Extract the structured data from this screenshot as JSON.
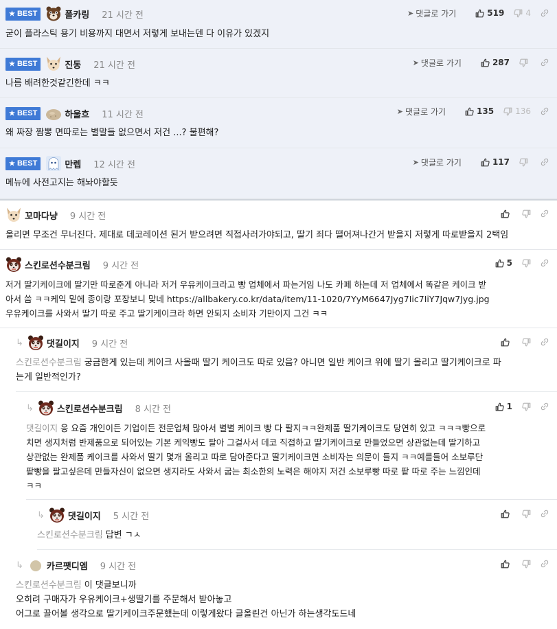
{
  "labels": {
    "best": "BEST",
    "goto_reply": "댓글로 가기"
  },
  "colors": {
    "best_bg": "#eef1f8",
    "badge": "#3f7ad6"
  },
  "best_comments": [
    {
      "nick": "폴카링",
      "time": "21 시간 전",
      "likes": "519",
      "dislikes": "4",
      "text": "굳이 플라스틱 용기 비용까지 대면서 저렇게 보내는덴 다 이유가 있겠지",
      "avatar": "bear-avatar-icon"
    },
    {
      "nick": "진동",
      "time": "21 시간 전",
      "likes": "287",
      "dislikes": "",
      "text": "나름 배려한것같긴한데 ㅋㅋ",
      "avatar": "fox-avatar-icon"
    },
    {
      "nick": "하울흐",
      "time": "11 시간 전",
      "likes": "135",
      "dislikes": "136",
      "text": "왜 짜장 짬뽕 면따로는 별말들 없으면서 저건 ...? 불편해?",
      "avatar": "potato-avatar-icon"
    },
    {
      "nick": "만렙",
      "time": "12 시간 전",
      "likes": "117",
      "dislikes": "",
      "text": "메뉴에 사전고지는 해놔야할듯",
      "avatar": "ghost-avatar-icon"
    }
  ],
  "comments": [
    {
      "nick": "꼬마다냥",
      "time": "9 시간 전",
      "likes": "",
      "lines": [
        "올리면 무조건 무너진다. 제대로 데코레이션 된거 받으려면 직접사러가야되고, 딸기 죄다 떨어져나간거 받을지 저렇게 따로받을지 2택임"
      ],
      "avatar": "fox-avatar-icon"
    },
    {
      "nick": "스킨로션수분크림",
      "time": "9 시간 전",
      "likes": "5",
      "lines": [
        "저거 딸기케이크에 딸기만 따로준게 아니라 저거 우유케이크라고 빵 업체에서 파는거임 나도 카페 하는데 저 업체에서 똑같은 케이크 받",
        "아서 씀 ㅋㅋ케익 밑에 종이랑 포장보니 맞네 https://allbakery.co.kr/data/item/11-1020/7YyM6647Jyg7Iic7IiY7Jqw7Jyg.jpg",
        "우유케이크를 사와서 딸기 따로 주고 딸기케이크라 하면 안되지 소비자 기만이지 그건 ㅋㅋ"
      ],
      "avatar": "panda-avatar-icon"
    }
  ],
  "replies": [
    {
      "nick": "댓길이지",
      "time": "9 시간 전",
      "likes": "",
      "mention": "스킨로션수분크림",
      "lines": [
        "궁금한게 있는데 케이크 사올때 딸기 케이크도 따로 있음? 아니면 일반 케이크 위에 딸기 올리고 딸기케이크로 파",
        "는게 일반적인가?"
      ],
      "avatar": "panda-avatar-icon"
    },
    {
      "nick": "스킨로션수분크림",
      "time": "8 시간 전",
      "likes": "1",
      "mention": "댓길이지",
      "lines": [
        "응 요즘 개인이든 기업이든 전문업체 많아서 별별 케이크 빵 다 팔지ㅋㅋ완제품 딸기케이크도 당연히 있고 ㅋㅋㅋ빵으로",
        "치면 생지처럼 반제품으로 되어있는 기본 케익빵도 팔아 그걸사서 데코 직접하고 딸기케이크로 만들었으면 상관없는데 딸기하고",
        "상관없는 완제품 케이크를 사와서 딸기 몇개 올리고 따로 담아준다고 딸기케이크면 소비자는 의문이 들지 ㅋㅋ예를들어 소보루단",
        "팥빵을 팔고싶은데 만들자신이 없으면 생지라도 사와서 굽는 최소한의 노력은 해야지 저건 소보루빵 따로 팥 따로 주는 느낌인데",
        "ㅋㅋ"
      ],
      "avatar": "panda-avatar-icon"
    },
    {
      "nick": "댓길이지",
      "time": "5 시간 전",
      "likes": "",
      "mention": "스킨로션수분크림",
      "lines": [
        "답변 ㄱㅅ"
      ],
      "avatar": "panda-avatar-icon"
    },
    {
      "nick": "카르팻디엠",
      "time": "9 시간 전",
      "likes": "",
      "mention": "스킨로션수분크림",
      "lines": [
        "이 댓글보니까",
        "오히려 구매자가 우유케이크+생딸기를 주문해서 받아놓고",
        "어그로 끌어볼 생각으로 딸기케이크주문했는데 이렇게왔다 글올린건 아닌가 하는생각도드네"
      ],
      "avatar": "dot-avatar-icon"
    }
  ]
}
